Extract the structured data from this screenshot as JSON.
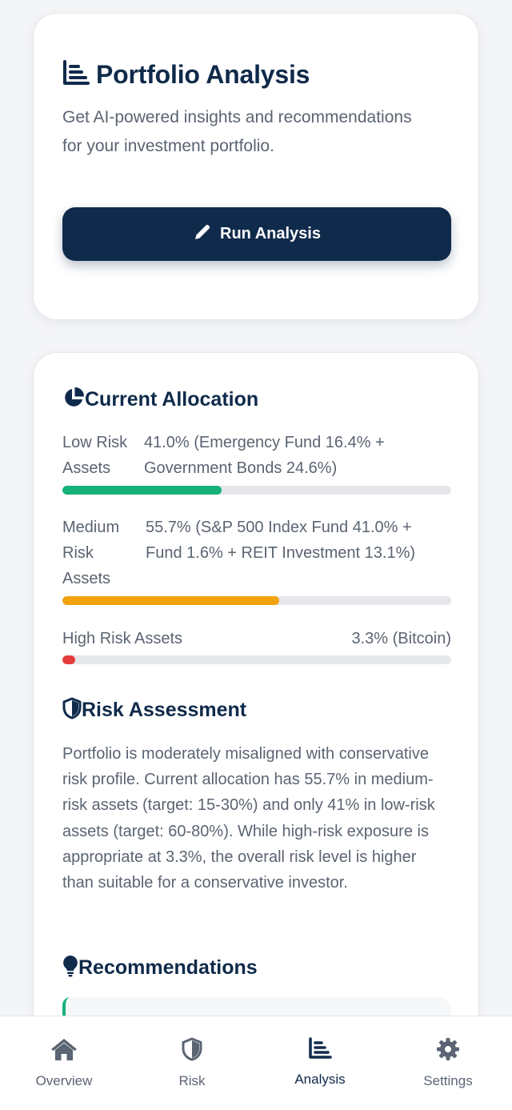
{
  "colors": {
    "primary": "#102a4c",
    "low_risk": "#16b27a",
    "medium_risk": "#f2a20c",
    "high_risk": "#e53b3b",
    "track": "#e5e7eb",
    "muted_text": "#5b6472"
  },
  "analysis_card": {
    "icon": "chart-icon",
    "title": "Portfolio Analysis",
    "description": "Get AI-powered insights and recommendations for your investment portfolio.",
    "button_icon": "pencil-icon",
    "button_label": "Run Analysis"
  },
  "allocation": {
    "icon": "pie-chart-icon",
    "title": "Current Allocation",
    "rows": [
      {
        "label": "Low Risk Assets",
        "value": "41.0% (Emergency Fund 16.4% + Government Bonds 24.6%)",
        "percent": 41.0,
        "color": "#16b27a"
      },
      {
        "label": "Medium Risk Assets",
        "value": "55.7% (S&P 500 Index Fund 41.0% + Fund 1.6% + REIT Investment 13.1%)",
        "percent": 55.7,
        "color": "#f2a20c"
      },
      {
        "label": "High Risk Assets",
        "value": "3.3% (Bitcoin)",
        "percent": 3.3,
        "color": "#e53b3b"
      }
    ]
  },
  "risk_assessment": {
    "icon": "shield-icon",
    "title": "Risk Assessment",
    "text": "Portfolio is moderately misaligned with conservative risk profile. Current allocation has 55.7% in medium-risk assets (target: 15-30%) and only 41% in low-risk assets (target: 60-80%). While high-risk exposure is appropriate at 3.3%, the overall risk level is higher than suitable for a conservative investor."
  },
  "recommendations": {
    "icon": "lightbulb-icon",
    "title": "Recommendations"
  },
  "nav": {
    "active": "Analysis",
    "items": [
      {
        "label": "Overview",
        "icon": "home-icon"
      },
      {
        "label": "Risk",
        "icon": "shield-icon"
      },
      {
        "label": "Analysis",
        "icon": "chart-icon"
      },
      {
        "label": "Settings",
        "icon": "gear-icon"
      }
    ]
  }
}
